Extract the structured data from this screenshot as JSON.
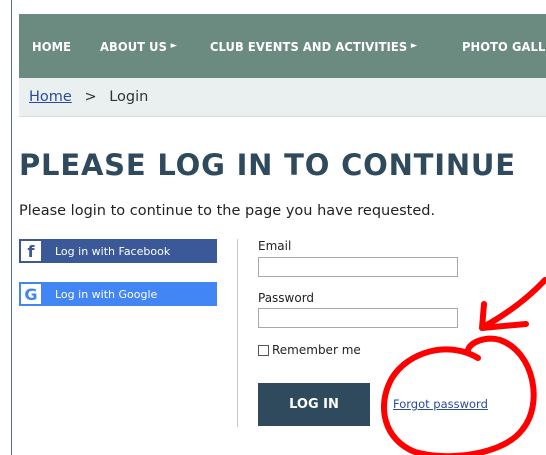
{
  "nav": {
    "items": [
      {
        "label": "HOME",
        "arrow": ""
      },
      {
        "label": "ABOUT US",
        "arrow": "►"
      },
      {
        "label": "CLUB EVENTS AND ACTIVITIES",
        "arrow": "►"
      },
      {
        "label": "PHOTO GALLERY",
        "arrow": "►"
      }
    ]
  },
  "breadcrumb": {
    "home": "Home",
    "separator": ">",
    "current": "Login"
  },
  "page": {
    "title": "PLEASE LOG IN TO CONTINUE",
    "intro": "Please login to continue to the page you have requested."
  },
  "social": {
    "facebook": {
      "icon": "f",
      "label": "Log in with Facebook"
    },
    "google": {
      "icon": "G",
      "label": "Log in with Google"
    }
  },
  "form": {
    "email_label": "Email",
    "email_value": "",
    "password_label": "Password",
    "password_value": "",
    "remember_label": "Remember me",
    "remember_checked": false,
    "login_label": "LOG IN",
    "forgot_label": "Forgot password"
  },
  "colors": {
    "nav_bg": "#6b8a80",
    "title": "#2e4a5c",
    "facebook": "#3b5998",
    "google": "#4285f4",
    "login_button": "#2e4a5c",
    "annotation": "#ff0000"
  }
}
